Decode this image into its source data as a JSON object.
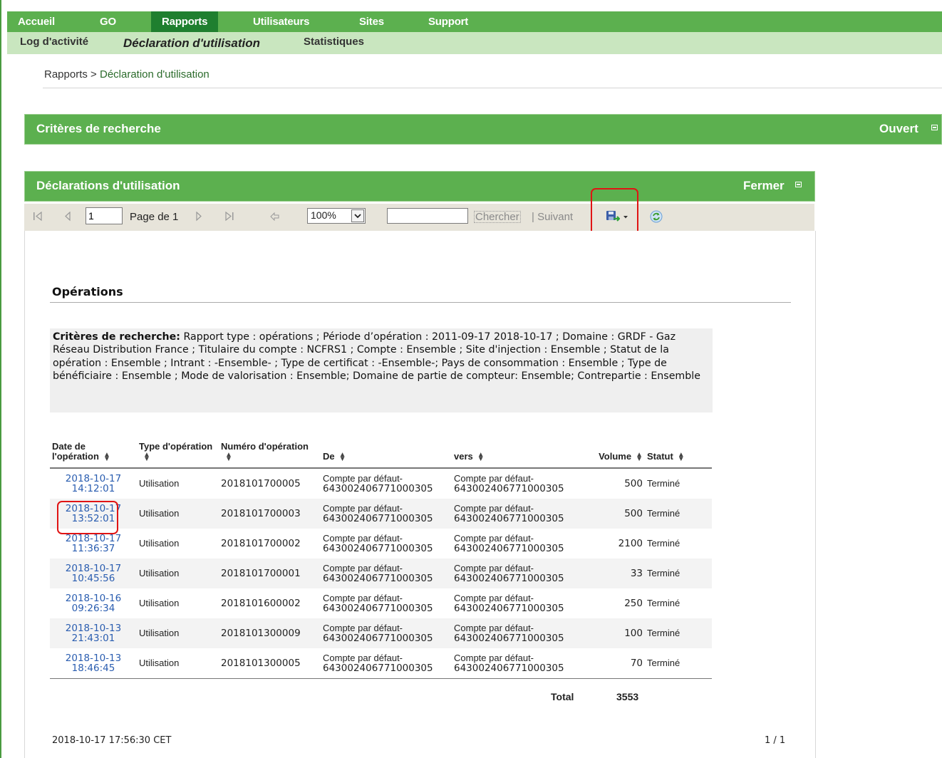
{
  "nav": {
    "items": [
      "Accueil",
      "GO",
      "Rapports",
      "Utilisateurs",
      "Sites",
      "Support"
    ],
    "active": "Rapports",
    "sub_items": [
      "Log d'activité",
      "Déclaration d'utilisation",
      "Statistiques"
    ],
    "sub_active": "Déclaration d'utilisation"
  },
  "breadcrumb": {
    "root": "Rapports",
    "separator": ">",
    "current": "Déclaration d'utilisation"
  },
  "search_panel": {
    "title": "Critères de recherche",
    "action": "Ouvert"
  },
  "results_panel": {
    "title": "Déclarations d'utilisation",
    "action": "Fermer"
  },
  "toolbar": {
    "page_value": "1",
    "page_label": "Page de 1",
    "zoom": "100%",
    "search_value": "",
    "search_button": "Chercher",
    "next_label": "| Suivant"
  },
  "report": {
    "title": "Opérations",
    "criteria_label": "Critères de recherche:",
    "criteria_text": " Rapport type : opérations ; Période d’opération : 2011-09-17 2018-10-17 ; Domaine : GRDF - Gaz Réseau Distribution France ; Titulaire du compte : NCFRS1 ; Compte : Ensemble ; Site d'injection : Ensemble ; Statut de la opération : Ensemble ; Intrant : -Ensemble- ; Type de certificat : -Ensemble-; Pays de consommation : Ensemble ; Type de bénéficiaire : Ensemble ; Mode de valorisation : Ensemble; Domaine de partie de compteur: Ensemble; Contrepartie : Ensemble",
    "columns": [
      "Date de l'opération",
      "Type d'opération",
      "Numéro d'opération",
      "De",
      "vers",
      "Volume",
      "Statut"
    ],
    "rows": [
      {
        "date": "2018-10-17",
        "time": "14:12:01",
        "type": "Utilisation",
        "number": "2018101700005",
        "from1": "Compte par défaut-",
        "from2": "643002406771000305",
        "to1": "Compte par défaut-",
        "to2": "643002406771000305",
        "volume": "500",
        "status": "Terminé"
      },
      {
        "date": "2018-10-17",
        "time": "13:52:01",
        "type": "Utilisation",
        "number": "2018101700003",
        "from1": "Compte par défaut-",
        "from2": "643002406771000305",
        "to1": "Compte par défaut-",
        "to2": "643002406771000305",
        "volume": "500",
        "status": "Terminé"
      },
      {
        "date": "2018-10-17",
        "time": "11:36:37",
        "type": "Utilisation",
        "number": "2018101700002",
        "from1": "Compte par défaut-",
        "from2": "643002406771000305",
        "to1": "Compte par défaut-",
        "to2": "643002406771000305",
        "volume": "2100",
        "status": "Terminé"
      },
      {
        "date": "2018-10-17",
        "time": "10:45:56",
        "type": "Utilisation",
        "number": "2018101700001",
        "from1": "Compte par défaut-",
        "from2": "643002406771000305",
        "to1": "Compte par défaut-",
        "to2": "643002406771000305",
        "volume": "33",
        "status": "Terminé"
      },
      {
        "date": "2018-10-16",
        "time": "09:26:34",
        "type": "Utilisation",
        "number": "2018101600002",
        "from1": "Compte par défaut-",
        "from2": "643002406771000305",
        "to1": "Compte par défaut-",
        "to2": "643002406771000305",
        "volume": "250",
        "status": "Terminé"
      },
      {
        "date": "2018-10-13",
        "time": "21:43:01",
        "type": "Utilisation",
        "number": "2018101300009",
        "from1": "Compte par défaut-",
        "from2": "643002406771000305",
        "to1": "Compte par défaut-",
        "to2": "643002406771000305",
        "volume": "100",
        "status": "Terminé"
      },
      {
        "date": "2018-10-13",
        "time": "18:46:45",
        "type": "Utilisation",
        "number": "2018101300005",
        "from1": "Compte par défaut-",
        "from2": "643002406771000305",
        "to1": "Compte par défaut-",
        "to2": "643002406771000305",
        "volume": "70",
        "status": "Terminé"
      }
    ],
    "total_label": "Total",
    "total_value": "3553",
    "generated_at": "2018-10-17 17:56:30 CET",
    "page_count": "1 / 1"
  },
  "colors": {
    "nav_green": "#5cb04f",
    "nav_active": "#1f7f2f",
    "subnav": "#c9e6bf",
    "link_blue": "#2a5db0",
    "highlight_red": "#e01414"
  }
}
